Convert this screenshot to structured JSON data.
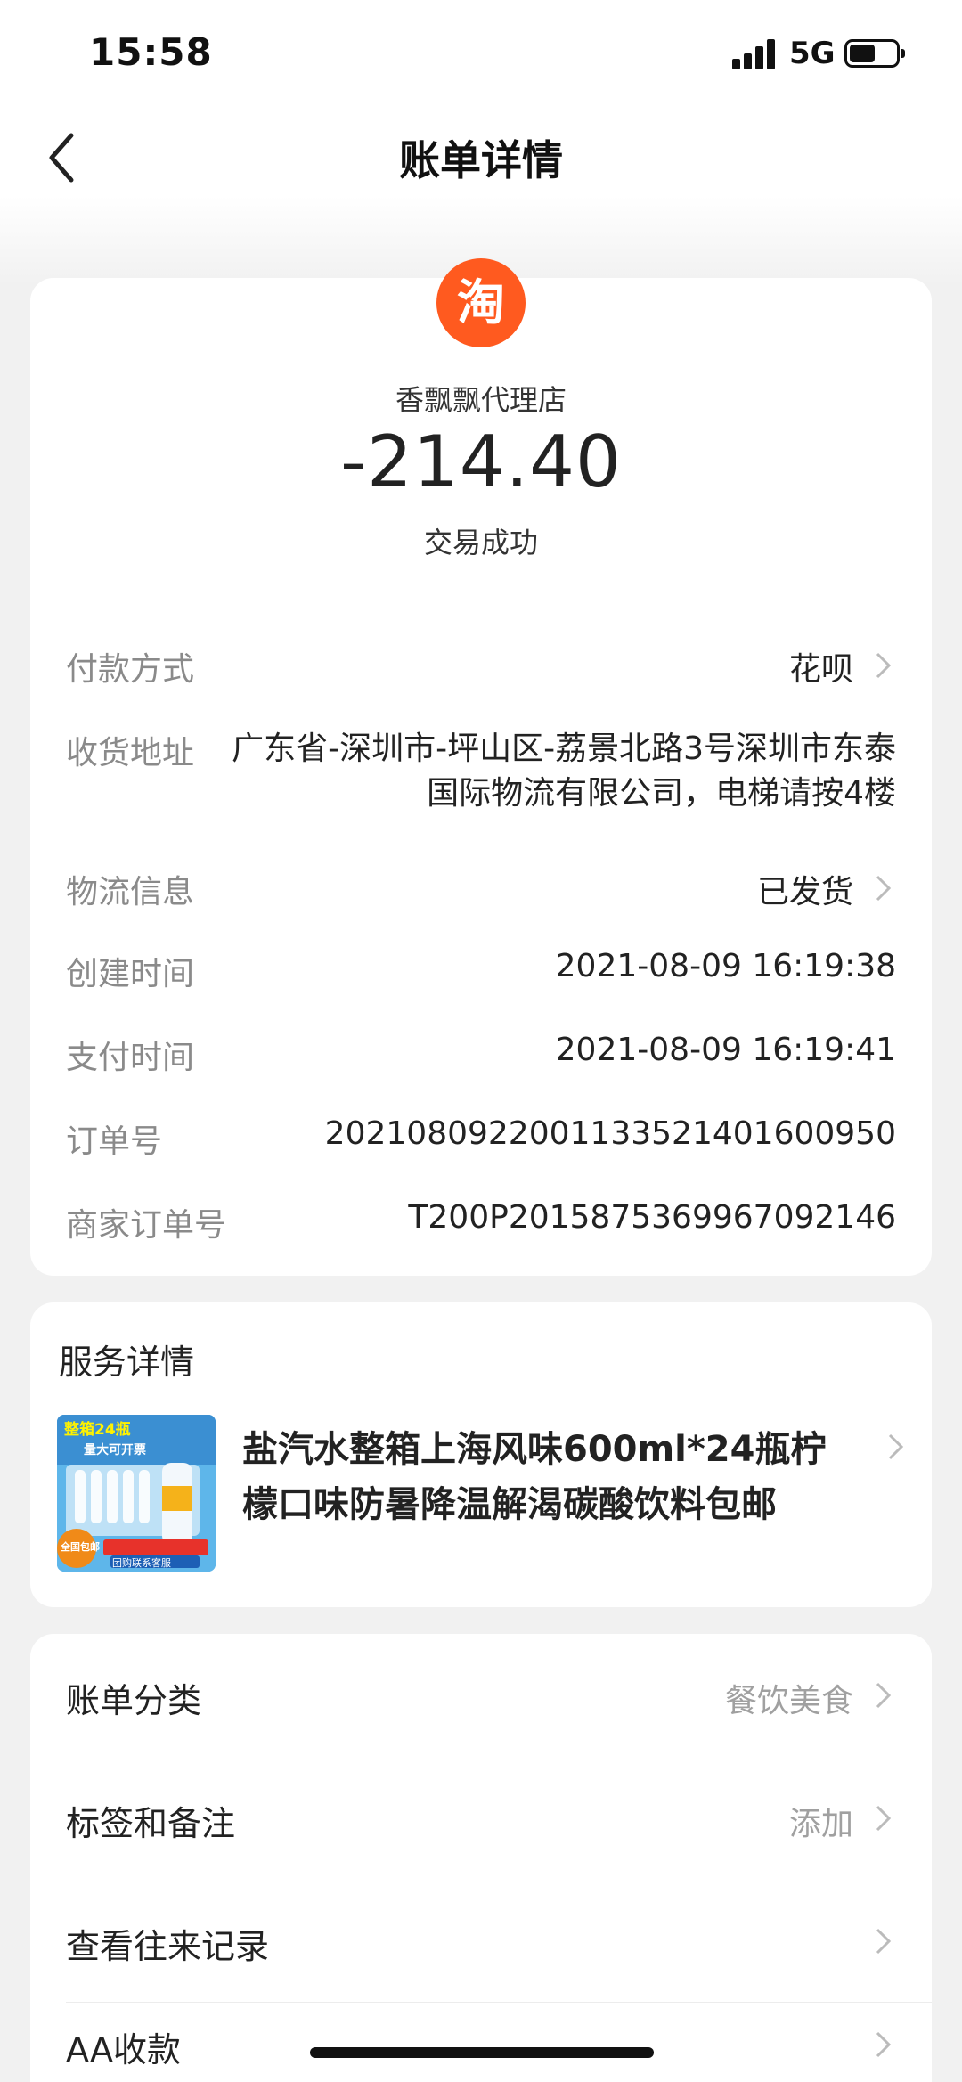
{
  "status_bar": {
    "time": "15:58",
    "network": "5G",
    "battery_level": 0.55
  },
  "header": {
    "title": "账单详情"
  },
  "transaction": {
    "merchant_logo_text": "淘",
    "merchant_name": "香飘飘代理店",
    "amount": "-214.40",
    "status": "交易成功"
  },
  "details": {
    "payment_method": {
      "label": "付款方式",
      "value": "花呗"
    },
    "address": {
      "label": "收货地址",
      "value": "广东省-深圳市-坪山区-荔景北路3号深圳市东泰国际物流有限公司，电梯请按4楼"
    },
    "logistics": {
      "label": "物流信息",
      "value": "已发货"
    },
    "created_time": {
      "label": "创建时间",
      "value": "2021-08-09 16:19:38"
    },
    "paid_time": {
      "label": "支付时间",
      "value": "2021-08-09 16:19:41"
    },
    "order_no": {
      "label": "订单号",
      "value": "2021080922001133521401600950"
    },
    "merchant_order_no": {
      "label": "商家订单号",
      "value": "T200P2015875369967092146"
    }
  },
  "service": {
    "title": "服务详情",
    "product_name": "盐汽水整箱上海风味600ml*24瓶柠檬口味防暑降温解渴碳酸饮料包邮",
    "product_image_text": {
      "badge": "整箱24瓶",
      "sub": "量大可开票",
      "corner": "全国包邮",
      "bottom": "团购联系客服"
    }
  },
  "actions": [
    {
      "label": "账单分类",
      "value": "餐饮美食"
    },
    {
      "label": "标签和备注",
      "value": "添加"
    },
    {
      "label": "查看往来记录",
      "value": ""
    },
    {
      "label": "AA收款",
      "value": ""
    }
  ],
  "colors": {
    "brand": "#ff5a1f",
    "label_gray": "#8a8a8a",
    "bg": "#f1f1f1"
  }
}
